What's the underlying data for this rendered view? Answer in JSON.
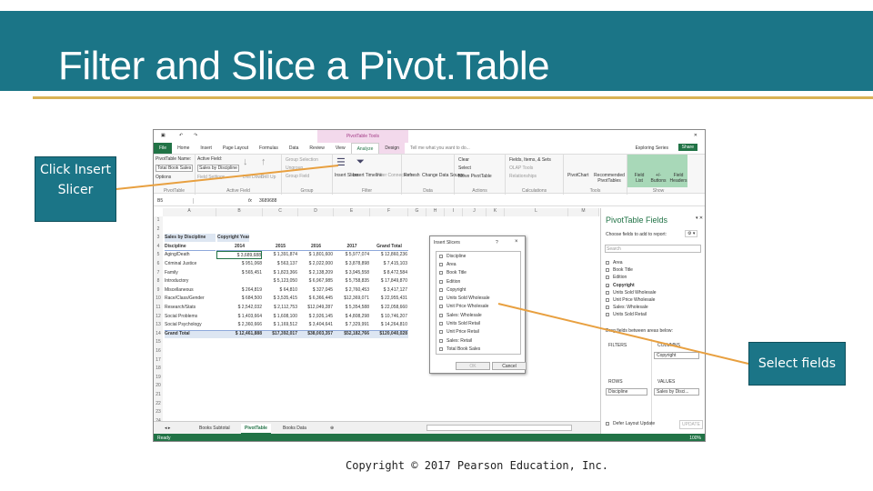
{
  "slide": {
    "title": "Filter and Slice a Pivot.Table",
    "callout_insert_slicer": "Click Insert Slicer",
    "callout_select_fields": "Select fields",
    "copyright": "Copyright © 2017 Pearson Education, Inc.",
    "colors": {
      "band": "#1b7587",
      "gold": "#d9b255",
      "excel_green": "#217346",
      "arrow": "#e8a040"
    }
  },
  "excel": {
    "contextual_tab": "PivotTable Tools",
    "tabs": [
      "File",
      "Home",
      "Insert",
      "Page Layout",
      "Formulas",
      "Data",
      "Review",
      "View",
      "Analyze",
      "Design"
    ],
    "tell_me": "Tell me what you want to do...",
    "account": "Exploring Series",
    "share": "Share",
    "ribbon": {
      "pivottable_name_label": "PivotTable Name:",
      "pivottable_name": "Total Book Sales",
      "options": "Options",
      "group_pivottable": "PivotTable",
      "active_field_label": "Active Field:",
      "active_field": "Sales by Discipline",
      "field_settings": "Field Settings",
      "drill_down": "Drill Down",
      "drill_up": "Drill Up",
      "group_active_field": "Active Field",
      "group_selection": "Group Selection",
      "ungroup": "Ungroup",
      "group_field": "Group Field",
      "group_group": "Group",
      "insert_slicer": "Insert Slicer",
      "insert_timeline": "Insert Timeline",
      "filter_connections": "Filter Connections",
      "group_filter": "Filter",
      "refresh": "Refresh",
      "change_data_source": "Change Data Source",
      "group_data": "Data",
      "clear": "Clear",
      "select": "Select",
      "move_pivottable": "Move PivotTable",
      "group_actions": "Actions",
      "fields_items_sets": "Fields, Items, & Sets",
      "olap_tools": "OLAP Tools",
      "relationships": "Relationships",
      "group_calculations": "Calculations",
      "pivotchart": "PivotChart",
      "recommended_pivottables": "Recommended PivotTables",
      "group_tools": "Tools",
      "field_list": "Field List",
      "buttons": "+/- Buttons",
      "field_headers": "Field Headers",
      "group_show": "Show"
    },
    "name_box": "B5",
    "fx": "fx",
    "formula": "3689688",
    "columns": [
      "A",
      "B",
      "C",
      "D",
      "E",
      "F",
      "G",
      "H",
      "I",
      "J",
      "K",
      "L",
      "M"
    ],
    "pivot": {
      "title": "Sales by Discipline",
      "col_field": "Copyright Year",
      "row_field": "Discipline",
      "headers": [
        "2014",
        "2015",
        "2016",
        "2017",
        "Grand Total"
      ],
      "rows": [
        [
          "Aging/Death",
          "$ 3,689,688",
          "$ 1,391,874",
          "$ 1,801,600",
          "$ 5,977,074",
          "$ 12,860,236"
        ],
        [
          "Criminal Justice",
          "$ 951,068",
          "$ 563,137",
          "$ 2,022,000",
          "$ 3,878,898",
          "$ 7,415,103"
        ],
        [
          "Family",
          "$ 565,451",
          "$ 1,823,366",
          "$ 2,138,209",
          "$ 3,945,558",
          "$ 8,472,584"
        ],
        [
          "Introductory",
          "",
          "$ 5,123,050",
          "$ 6,967,985",
          "$ 5,758,835",
          "$ 17,849,870"
        ],
        [
          "Miscellaneous",
          "$ 264,819",
          "$ 64,810",
          "$ 327,045",
          "$ 2,760,453",
          "$ 3,417,127"
        ],
        [
          "Race/Class/Gender",
          "$ 684,500",
          "$ 3,535,415",
          "$ 6,366,445",
          "$12,369,071",
          "$ 22,955,431"
        ],
        [
          "Research/Stats",
          "$ 2,542,032",
          "$ 2,112,753",
          "$12,049,287",
          "$ 5,354,588",
          "$ 22,058,660"
        ],
        [
          "Social Problems",
          "$ 1,403,664",
          "$ 1,608,100",
          "$ 2,926,145",
          "$ 4,808,298",
          "$ 10,746,207"
        ],
        [
          "Social Psychology",
          "$ 2,360,666",
          "$ 1,169,512",
          "$ 3,404,641",
          "$ 7,329,991",
          "$ 14,264,810"
        ]
      ],
      "total": [
        "Grand Total",
        "$ 12,461,888",
        "$17,392,017",
        "$38,003,357",
        "$52,182,766",
        "$120,040,028"
      ]
    },
    "slicer_dialog": {
      "title": "Insert Slicers",
      "help": "?",
      "close": "×",
      "fields": [
        "Discipline",
        "Area",
        "Book Title",
        "Edition",
        "Copyright",
        "Units Sold Wholesale",
        "Unit Price Wholesale",
        "Sales: Wholesale",
        "Units Sold Retail",
        "Unit Price Retail",
        "Sales: Retail",
        "Total Book Sales"
      ],
      "ok": "OK",
      "cancel": "Cancel"
    },
    "fields_pane": {
      "title": "PivotTable Fields",
      "choose": "Choose fields to add to report:",
      "search_placeholder": "Search",
      "fields": [
        {
          "name": "Area",
          "checked": false
        },
        {
          "name": "Book Title",
          "checked": false
        },
        {
          "name": "Edition",
          "checked": false
        },
        {
          "name": "Copyright",
          "checked": true
        },
        {
          "name": "Units Sold Wholesale",
          "checked": false
        },
        {
          "name": "Unit Price Wholesale",
          "checked": false
        },
        {
          "name": "Sales: Wholesale",
          "checked": false
        },
        {
          "name": "Units Sold Retail",
          "checked": false
        }
      ],
      "drag": "Drag fields between areas below:",
      "filters": "FILTERS",
      "columns": "COLUMNS",
      "columns_value": "Copyright",
      "rows": "ROWS",
      "rows_value": "Discipline",
      "values": "VALUES",
      "values_value": "Sales by Disci...",
      "defer": "Defer Layout Update",
      "update": "UPDATE"
    },
    "sheets": [
      "Books Subtotal",
      "PivotTable",
      "Books Data"
    ],
    "active_sheet": "PivotTable",
    "status": "Ready",
    "zoom": "100%"
  }
}
